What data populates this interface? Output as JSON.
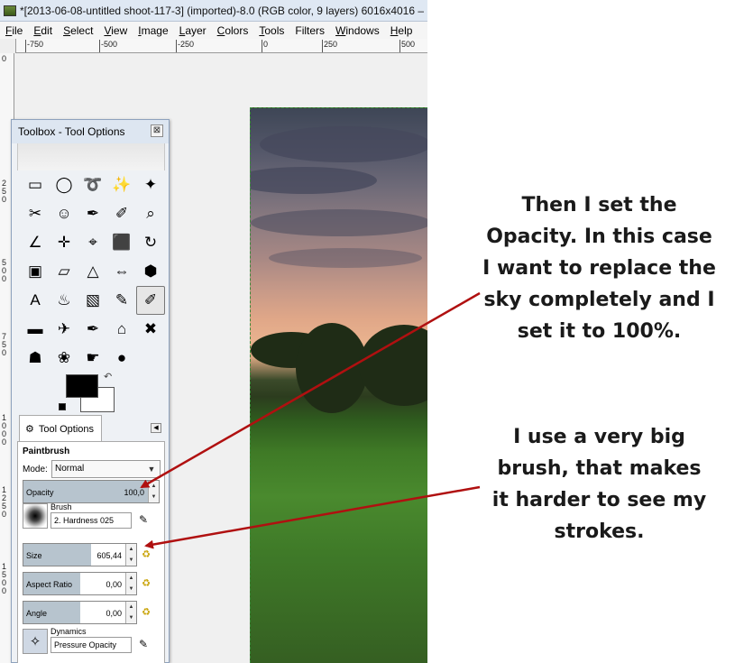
{
  "window": {
    "title": "*[2013-06-08-untitled shoot-117-3] (imported)-8.0 (RGB color, 9 layers) 6016x4016 –"
  },
  "menubar": {
    "items": [
      {
        "u": "F",
        "rest": "ile"
      },
      {
        "u": "E",
        "rest": "dit"
      },
      {
        "u": "S",
        "rest": "elect"
      },
      {
        "u": "V",
        "rest": "iew"
      },
      {
        "u": "I",
        "rest": "mage"
      },
      {
        "u": "L",
        "rest": "ayer"
      },
      {
        "u": "C",
        "rest": "olors"
      },
      {
        "u": "T",
        "rest": "ools"
      },
      {
        "u": "",
        "rest": "Filters"
      },
      {
        "u": "W",
        "rest": "indows"
      },
      {
        "u": "H",
        "rest": "elp"
      }
    ]
  },
  "ruler": {
    "h_labels": [
      "-750",
      "-500",
      "-250",
      "0",
      "250",
      "500"
    ],
    "v_labels": [
      "0",
      "2 5 0",
      "5 0 0",
      "7 5 0",
      "1 0 0 0",
      "1 2 5 0",
      "1 5 0 0"
    ]
  },
  "toolbox": {
    "title": "Toolbox - Tool Options",
    "close_glyph": "⊠",
    "tools": [
      "rect-select",
      "ellipse-select",
      "free-select",
      "fuzzy-select",
      "color-select",
      "scissors",
      "foreground-select",
      "paths",
      "color-picker",
      "zoom",
      "measure",
      "move",
      "align",
      "crop",
      "rotate",
      "scale",
      "shear",
      "perspective",
      "flip",
      "cage",
      "text",
      "bucket-fill",
      "blend",
      "pencil",
      "paintbrush",
      "eraser",
      "airbrush",
      "ink",
      "clone",
      "heal",
      "perspective-clone",
      "blur",
      "smudge",
      "dodge-burn"
    ],
    "tool_glyphs": [
      "▭",
      "◯",
      "➰",
      "✨",
      "✦",
      "✂",
      "☺",
      "✒",
      "✐",
      "⌕",
      "∠",
      "✛",
      "⌖",
      "⬛",
      "↻",
      "▣",
      "▱",
      "△",
      "⇔",
      "⬢",
      "A",
      "♨",
      "▧",
      "✎",
      "✐",
      "▬",
      "✈",
      "✒",
      "⌂",
      "✖",
      "☗",
      "❀",
      "☛",
      "●"
    ],
    "colors": {
      "foreground": "#000000",
      "background": "#ffffff"
    }
  },
  "tool_options": {
    "tab_label": "Tool Options",
    "heading": "Paintbrush",
    "mode_label": "Mode:",
    "mode_value": "Normal",
    "opacity": {
      "label": "Opacity",
      "value": "100,0",
      "fraction": 1.0
    },
    "brush": {
      "label": "Brush",
      "value": "2. Hardness 025"
    },
    "size": {
      "label": "Size",
      "value": "605,44",
      "fraction": 0.6
    },
    "aspect_ratio": {
      "label": "Aspect Ratio",
      "value": "0,00",
      "fraction": 0.5
    },
    "angle": {
      "label": "Angle",
      "value": "0,00",
      "fraction": 0.5
    },
    "dynamics": {
      "label": "Dynamics",
      "value": "Pressure Opacity"
    }
  },
  "annotations": {
    "note1": [
      "Then I set the",
      "Opacity. In this case",
      "I want to replace the",
      "sky completely and I",
      "set it to 100%."
    ],
    "note2": [
      "I use a very big",
      "brush, that makes",
      "it harder to see my",
      "strokes."
    ],
    "arrow_color": "#b01010"
  }
}
